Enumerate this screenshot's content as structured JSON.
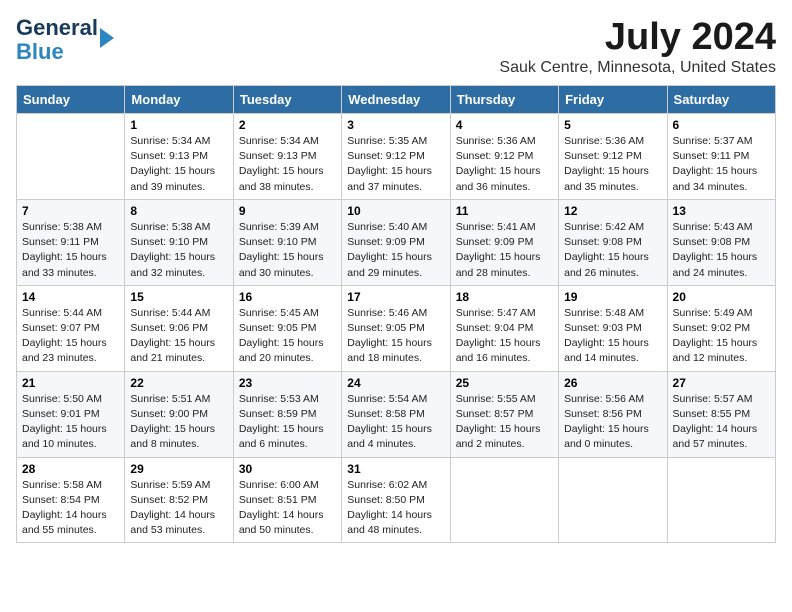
{
  "logo": {
    "line1": "General",
    "line2": "Blue"
  },
  "title": "July 2024",
  "subtitle": "Sauk Centre, Minnesota, United States",
  "headers": [
    "Sunday",
    "Monday",
    "Tuesday",
    "Wednesday",
    "Thursday",
    "Friday",
    "Saturday"
  ],
  "weeks": [
    [
      {
        "day": "",
        "info": ""
      },
      {
        "day": "1",
        "info": "Sunrise: 5:34 AM\nSunset: 9:13 PM\nDaylight: 15 hours\nand 39 minutes."
      },
      {
        "day": "2",
        "info": "Sunrise: 5:34 AM\nSunset: 9:13 PM\nDaylight: 15 hours\nand 38 minutes."
      },
      {
        "day": "3",
        "info": "Sunrise: 5:35 AM\nSunset: 9:12 PM\nDaylight: 15 hours\nand 37 minutes."
      },
      {
        "day": "4",
        "info": "Sunrise: 5:36 AM\nSunset: 9:12 PM\nDaylight: 15 hours\nand 36 minutes."
      },
      {
        "day": "5",
        "info": "Sunrise: 5:36 AM\nSunset: 9:12 PM\nDaylight: 15 hours\nand 35 minutes."
      },
      {
        "day": "6",
        "info": "Sunrise: 5:37 AM\nSunset: 9:11 PM\nDaylight: 15 hours\nand 34 minutes."
      }
    ],
    [
      {
        "day": "7",
        "info": "Sunrise: 5:38 AM\nSunset: 9:11 PM\nDaylight: 15 hours\nand 33 minutes."
      },
      {
        "day": "8",
        "info": "Sunrise: 5:38 AM\nSunset: 9:10 PM\nDaylight: 15 hours\nand 32 minutes."
      },
      {
        "day": "9",
        "info": "Sunrise: 5:39 AM\nSunset: 9:10 PM\nDaylight: 15 hours\nand 30 minutes."
      },
      {
        "day": "10",
        "info": "Sunrise: 5:40 AM\nSunset: 9:09 PM\nDaylight: 15 hours\nand 29 minutes."
      },
      {
        "day": "11",
        "info": "Sunrise: 5:41 AM\nSunset: 9:09 PM\nDaylight: 15 hours\nand 28 minutes."
      },
      {
        "day": "12",
        "info": "Sunrise: 5:42 AM\nSunset: 9:08 PM\nDaylight: 15 hours\nand 26 minutes."
      },
      {
        "day": "13",
        "info": "Sunrise: 5:43 AM\nSunset: 9:08 PM\nDaylight: 15 hours\nand 24 minutes."
      }
    ],
    [
      {
        "day": "14",
        "info": "Sunrise: 5:44 AM\nSunset: 9:07 PM\nDaylight: 15 hours\nand 23 minutes."
      },
      {
        "day": "15",
        "info": "Sunrise: 5:44 AM\nSunset: 9:06 PM\nDaylight: 15 hours\nand 21 minutes."
      },
      {
        "day": "16",
        "info": "Sunrise: 5:45 AM\nSunset: 9:05 PM\nDaylight: 15 hours\nand 20 minutes."
      },
      {
        "day": "17",
        "info": "Sunrise: 5:46 AM\nSunset: 9:05 PM\nDaylight: 15 hours\nand 18 minutes."
      },
      {
        "day": "18",
        "info": "Sunrise: 5:47 AM\nSunset: 9:04 PM\nDaylight: 15 hours\nand 16 minutes."
      },
      {
        "day": "19",
        "info": "Sunrise: 5:48 AM\nSunset: 9:03 PM\nDaylight: 15 hours\nand 14 minutes."
      },
      {
        "day": "20",
        "info": "Sunrise: 5:49 AM\nSunset: 9:02 PM\nDaylight: 15 hours\nand 12 minutes."
      }
    ],
    [
      {
        "day": "21",
        "info": "Sunrise: 5:50 AM\nSunset: 9:01 PM\nDaylight: 15 hours\nand 10 minutes."
      },
      {
        "day": "22",
        "info": "Sunrise: 5:51 AM\nSunset: 9:00 PM\nDaylight: 15 hours\nand 8 minutes."
      },
      {
        "day": "23",
        "info": "Sunrise: 5:53 AM\nSunset: 8:59 PM\nDaylight: 15 hours\nand 6 minutes."
      },
      {
        "day": "24",
        "info": "Sunrise: 5:54 AM\nSunset: 8:58 PM\nDaylight: 15 hours\nand 4 minutes."
      },
      {
        "day": "25",
        "info": "Sunrise: 5:55 AM\nSunset: 8:57 PM\nDaylight: 15 hours\nand 2 minutes."
      },
      {
        "day": "26",
        "info": "Sunrise: 5:56 AM\nSunset: 8:56 PM\nDaylight: 15 hours\nand 0 minutes."
      },
      {
        "day": "27",
        "info": "Sunrise: 5:57 AM\nSunset: 8:55 PM\nDaylight: 14 hours\nand 57 minutes."
      }
    ],
    [
      {
        "day": "28",
        "info": "Sunrise: 5:58 AM\nSunset: 8:54 PM\nDaylight: 14 hours\nand 55 minutes."
      },
      {
        "day": "29",
        "info": "Sunrise: 5:59 AM\nSunset: 8:52 PM\nDaylight: 14 hours\nand 53 minutes."
      },
      {
        "day": "30",
        "info": "Sunrise: 6:00 AM\nSunset: 8:51 PM\nDaylight: 14 hours\nand 50 minutes."
      },
      {
        "day": "31",
        "info": "Sunrise: 6:02 AM\nSunset: 8:50 PM\nDaylight: 14 hours\nand 48 minutes."
      },
      {
        "day": "",
        "info": ""
      },
      {
        "day": "",
        "info": ""
      },
      {
        "day": "",
        "info": ""
      }
    ]
  ]
}
